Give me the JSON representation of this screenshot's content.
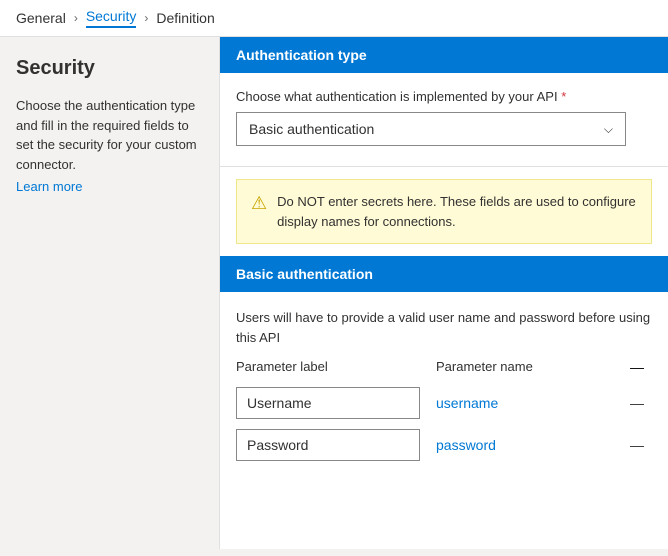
{
  "breadcrumb": {
    "items": [
      {
        "label": "General",
        "active": false
      },
      {
        "label": "Security",
        "active": true
      },
      {
        "label": "Definition",
        "active": false
      }
    ]
  },
  "sidebar": {
    "title": "Security",
    "description": "Choose the authentication type and fill in the required fields to set the security for your custom connector.",
    "learn_more": "Learn more"
  },
  "auth_type_section": {
    "header": "Authentication type",
    "label": "Choose what authentication is implemented by your API",
    "required": "*",
    "dropdown_value": "Basic authentication",
    "dropdown_arrow": "⌄"
  },
  "warning": {
    "icon": "⚠",
    "text": "Do NOT enter secrets here. These fields are used to configure display names for connections."
  },
  "basic_auth": {
    "header": "Basic authentication",
    "description": "Users will have to provide a valid user name and password before using this API",
    "columns": {
      "label": "Parameter label",
      "name": "Parameter name"
    },
    "parameters": [
      {
        "label": "Username",
        "name": "username"
      },
      {
        "label": "Password",
        "name": "password"
      }
    ]
  }
}
